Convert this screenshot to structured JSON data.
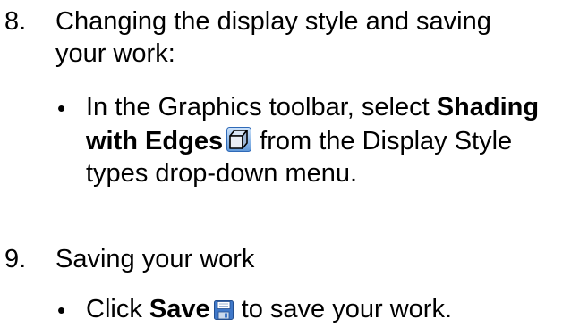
{
  "steps": [
    {
      "number": "8.",
      "title_line1": "Changing the display style and saving",
      "title_line2": "your work:",
      "bullet": {
        "line1_prefix": "In the Graphics toolbar, select ",
        "line1_bold": "Shading",
        "line2_bold": "with Edges",
        "line2_icon": "shaded-cube-icon",
        "line2_suffix": " from the Display Style",
        "line3": "types drop-down menu."
      }
    },
    {
      "number": "9.",
      "title_line1": "Saving your work",
      "bullet": {
        "prefix": "Click ",
        "bold": "Save",
        "icon": "save-floppy-icon",
        "suffix": " to save your work."
      }
    }
  ],
  "bullet_glyph": "•"
}
